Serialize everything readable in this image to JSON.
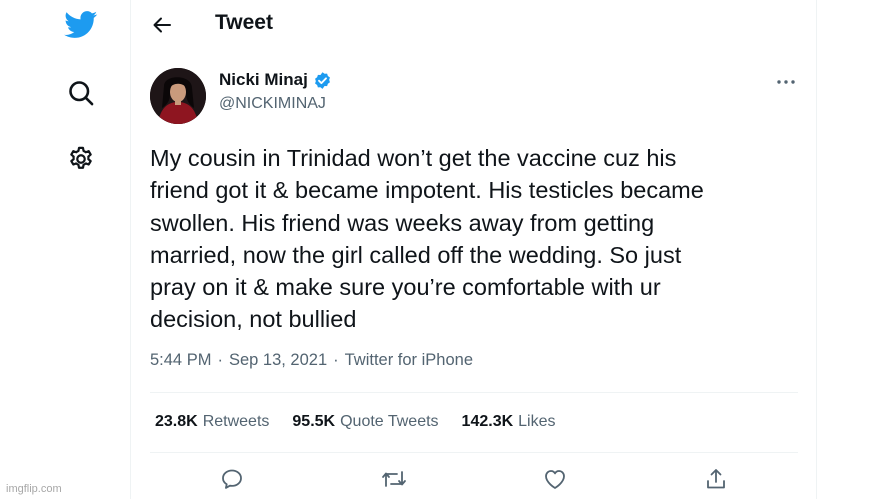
{
  "colors": {
    "brand": "#1d9bf0",
    "text": "#0f1419",
    "muted": "#536471"
  },
  "rail": {
    "icons": [
      "twitter-logo-icon",
      "search-icon",
      "gear-icon"
    ]
  },
  "topbar": {
    "back_icon": "arrow-left-icon",
    "title": "Tweet"
  },
  "author": {
    "name": "Nicki Minaj",
    "handle": "@NICKIMINAJ",
    "verified": true
  },
  "tweet": {
    "text": "My cousin in Trinidad won’t get the vaccine cuz his\nfriend got it & became impotent. His testicles became\nswollen. His friend was weeks away from getting\nmarried, now the girl called off the wedding. So just\npray on it & make sure you’re comfortable with ur\ndecision, not bullied",
    "time": "5:44 PM",
    "sep1": "·",
    "date": "Sep 13, 2021",
    "sep2": "·",
    "source": "Twitter for iPhone"
  },
  "stats": {
    "retweets": {
      "count": "23.8K",
      "label": "Retweets"
    },
    "quotes": {
      "count": "95.5K",
      "label": "Quote Tweets"
    },
    "likes": {
      "count": "142.3K",
      "label": "Likes"
    }
  },
  "actions": [
    "reply-icon",
    "retweet-icon",
    "like-icon",
    "share-icon"
  ],
  "watermark": "imgflip.com"
}
